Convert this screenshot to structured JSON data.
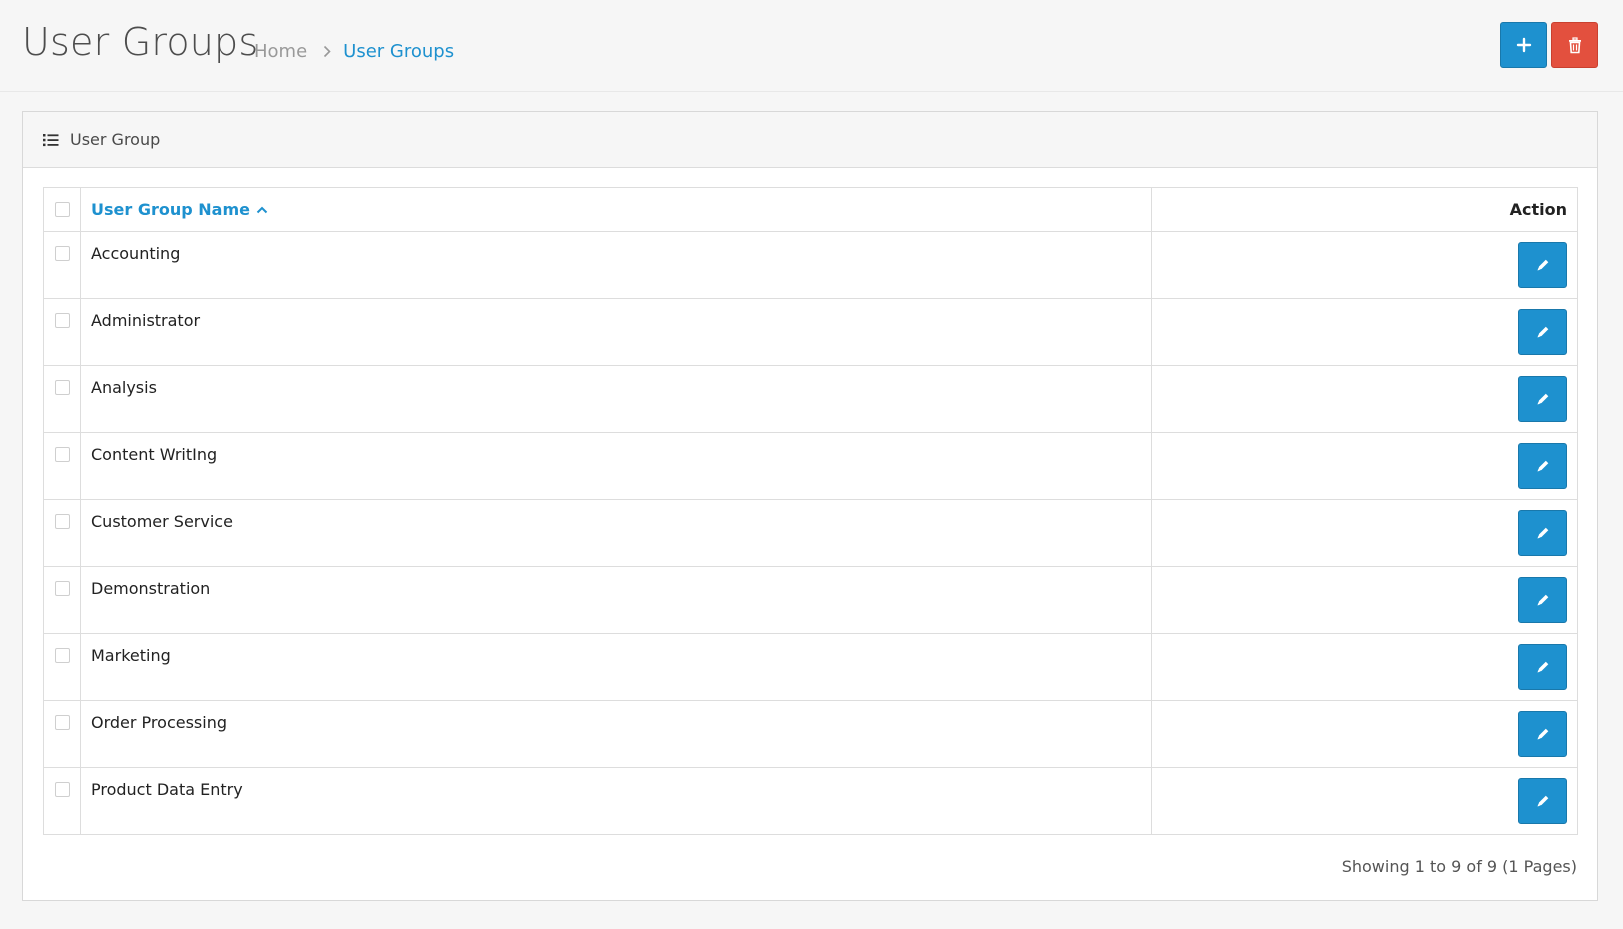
{
  "header": {
    "title": "User Groups",
    "breadcrumb": {
      "home": "Home",
      "current": "User Groups"
    },
    "buttons": {
      "add_icon": "plus-icon",
      "delete_icon": "trash-icon"
    }
  },
  "panel": {
    "title": "User Group",
    "icon": "list-icon"
  },
  "table": {
    "columns": {
      "name": "User Group Name",
      "name_sort": "ascending",
      "action": "Action"
    },
    "rows": [
      {
        "name": "Accounting"
      },
      {
        "name": "Administrator"
      },
      {
        "name": "Analysis"
      },
      {
        "name": "Content WritIng"
      },
      {
        "name": "Customer Service"
      },
      {
        "name": "Demonstration"
      },
      {
        "name": "Marketing"
      },
      {
        "name": "Order Processing"
      },
      {
        "name": "Product Data Entry"
      }
    ],
    "row_action_icon": "pencil-icon"
  },
  "pagination": {
    "info": "Showing 1 to 9 of 9 (1 Pages)"
  },
  "colors": {
    "primary": "#1e91cf",
    "danger": "#e3503e",
    "background": "#f6f6f6"
  }
}
